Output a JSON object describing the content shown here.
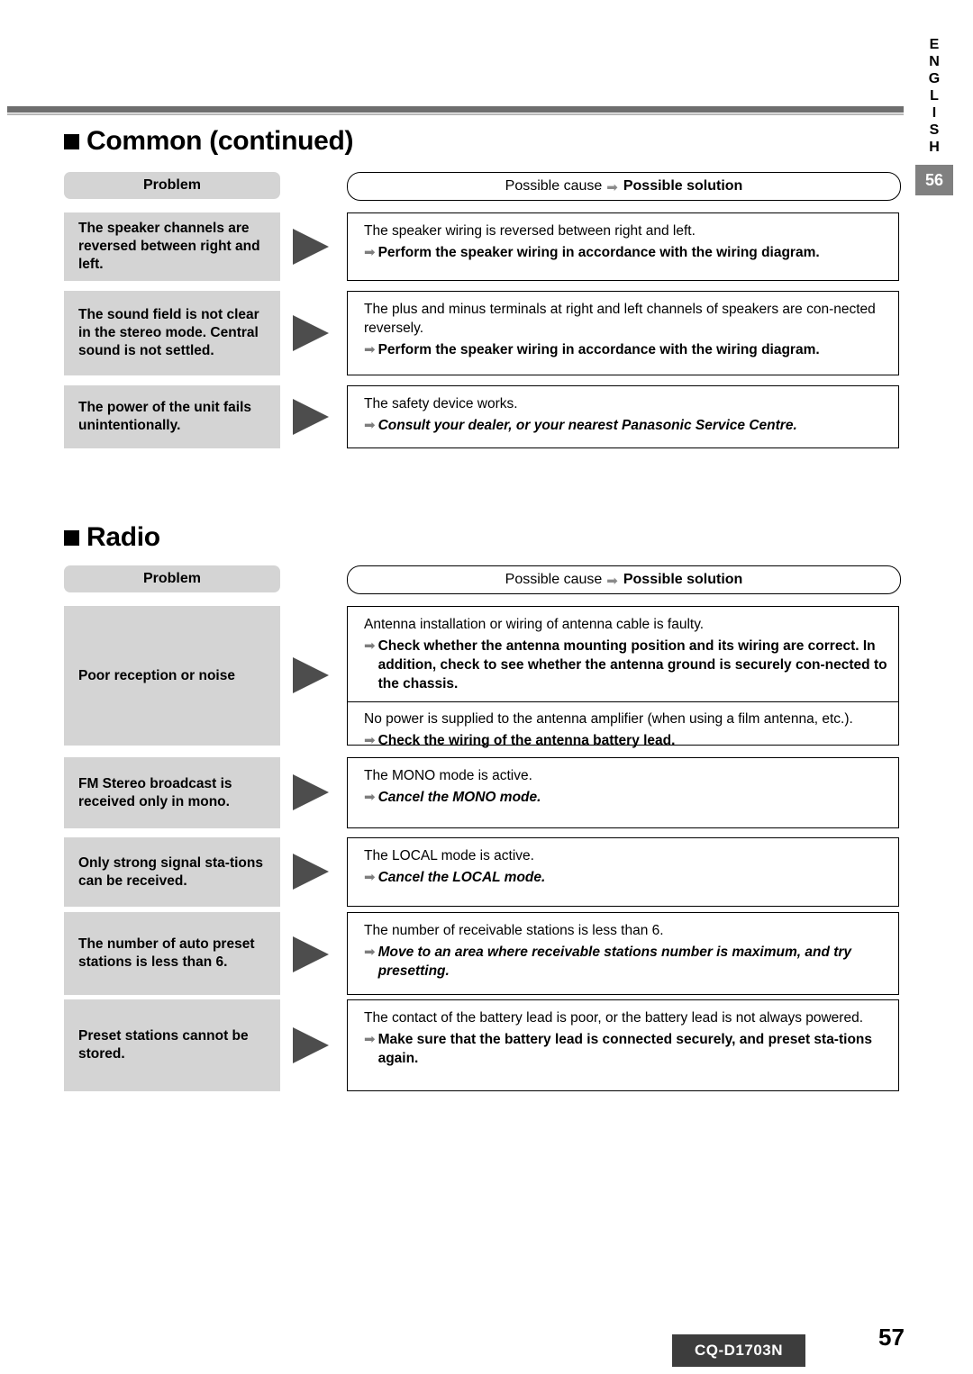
{
  "lang_tab": {
    "letters": [
      "E",
      "N",
      "G",
      "L",
      "I",
      "S",
      "H"
    ],
    "page_number": "56"
  },
  "sections": [
    {
      "title": "Common (continued)",
      "header": {
        "problem_label": "Problem",
        "cause_prefix": "Possible cause",
        "cause_suffix": "Possible solution"
      },
      "rows": [
        {
          "problem": "The speaker channels are reversed between right and left.",
          "blocks": [
            {
              "cause": "The speaker wiring is reversed between right and left.",
              "solutions": [
                {
                  "text": "Perform the speaker wiring in accordance with the wiring diagram.",
                  "italic": false
                }
              ]
            }
          ]
        },
        {
          "problem": "The sound field is not clear in the stereo mode. Central sound is not settled.",
          "blocks": [
            {
              "cause": "The plus and minus terminals at right and left channels of speakers are con-nected reversely.",
              "solutions": [
                {
                  "text": "Perform the speaker wiring in accordance with the wiring diagram.",
                  "italic": false
                }
              ]
            }
          ]
        },
        {
          "problem": "The power of the unit fails unintentionally.",
          "blocks": [
            {
              "cause": "The safety device works.",
              "solutions": [
                {
                  "text": "Consult your dealer, or your nearest Panasonic Service Centre.",
                  "italic": true
                }
              ]
            }
          ]
        }
      ]
    },
    {
      "title": "Radio",
      "header": {
        "problem_label": "Problem",
        "cause_prefix": "Possible cause",
        "cause_suffix": "Possible solution"
      },
      "rows": [
        {
          "problem": "Poor reception or noise",
          "blocks": [
            {
              "cause": "Antenna installation or wiring of antenna cable is faulty.",
              "solutions": [
                {
                  "text": "Check whether the antenna mounting position and its wiring are correct. In addition, check to see whether the antenna ground is securely con-nected to the chassis.",
                  "italic": false
                }
              ]
            },
            {
              "cause": "No power is supplied to the antenna amplifier (when using a film antenna, etc.).",
              "solutions": [
                {
                  "text": "Check the wiring of the antenna battery lead.",
                  "italic": false
                }
              ]
            }
          ]
        },
        {
          "problem": "FM Stereo broadcast is received only in mono.",
          "blocks": [
            {
              "cause": "The MONO mode is active.",
              "solutions": [
                {
                  "text": "Cancel the MONO mode.",
                  "italic": true
                }
              ]
            }
          ]
        },
        {
          "problem": "Only strong signal sta-tions can be received.",
          "blocks": [
            {
              "cause": "The LOCAL mode is active.",
              "solutions": [
                {
                  "text": "Cancel the LOCAL mode.",
                  "italic": true
                }
              ]
            }
          ]
        },
        {
          "problem": "The number of auto preset stations is less than 6.",
          "blocks": [
            {
              "cause": "The number of receivable stations is less than 6.",
              "solutions": [
                {
                  "text": "Move to an area where receivable stations number is maximum, and try presetting.",
                  "italic": true
                }
              ]
            }
          ]
        },
        {
          "problem": "Preset stations cannot be stored.",
          "blocks": [
            {
              "cause": "The contact of the battery lead is poor, or the battery lead is not always powered.",
              "solutions": [
                {
                  "text": "Make sure that the battery lead is connected securely, and preset sta-tions again.",
                  "italic": false
                }
              ]
            }
          ]
        }
      ]
    }
  ],
  "footer": {
    "model": "CQ-D1703N",
    "page_number": "57"
  }
}
